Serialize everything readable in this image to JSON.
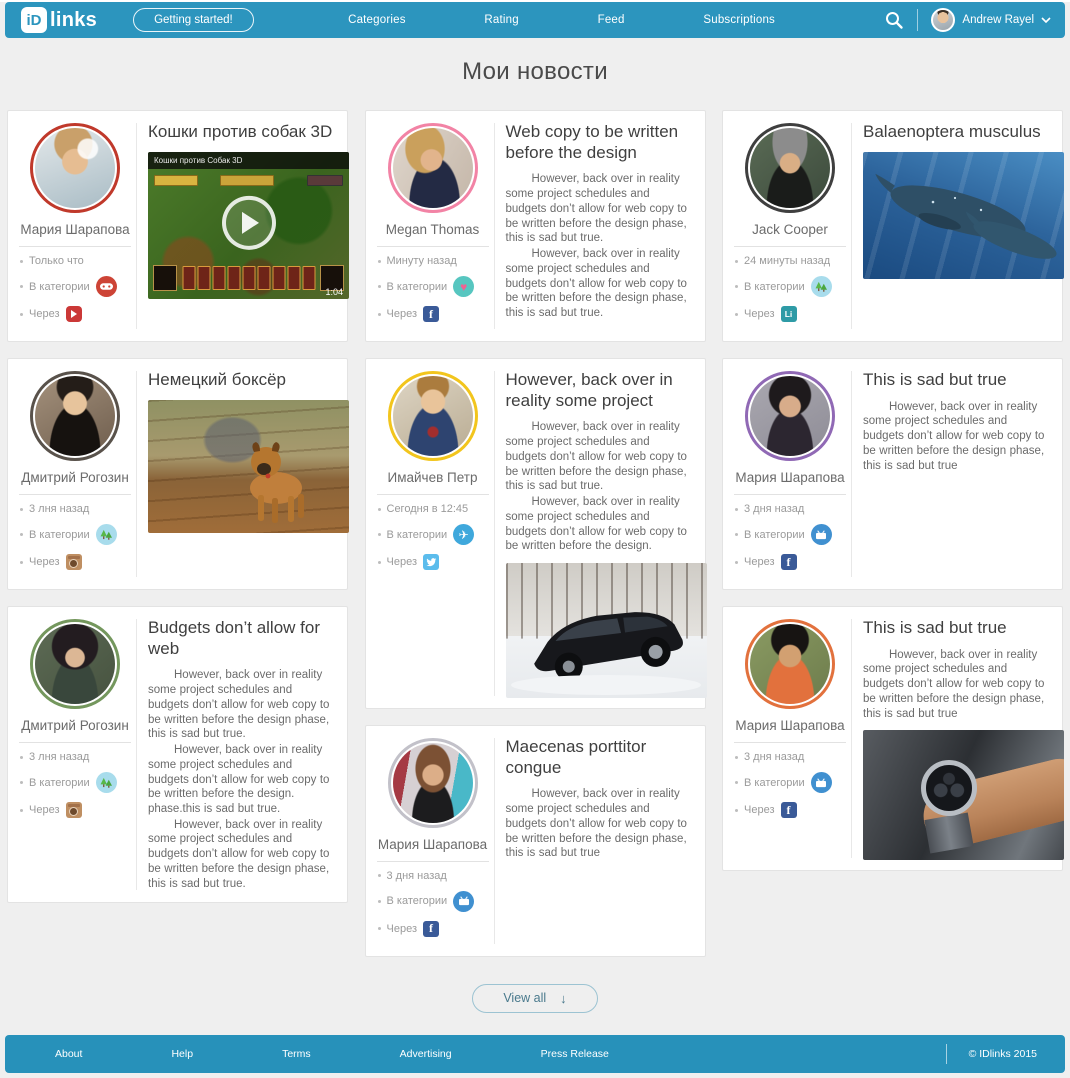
{
  "header": {
    "logo": {
      "badge": "iD",
      "text": "links"
    },
    "getting_started_label": "Getting started!",
    "nav_items": [
      "Categories",
      "Rating",
      "Feed",
      "Subscriptions"
    ],
    "user_menu": {
      "name": "Andrew Rayel"
    }
  },
  "page": {
    "title": "Мои новости"
  },
  "icons": {
    "facebook_glyph": "f",
    "linkedin_glyph": "Li",
    "heart_glyph": "♥",
    "plane_glyph": "✈",
    "view_all_arrow": "↓"
  },
  "colors": {
    "header_bg": "#2c95be",
    "footer_bg": "#2791ba",
    "page_bg": "#efefef",
    "card_bg": "#ffffff",
    "facebook_blue": "#3a5a98",
    "twitter_blue": "#5bbcec",
    "youtube_red": "#cb3837",
    "instagram_tan": "#bf8f62",
    "linkedin_teal": "#2e9ba6",
    "category_games_red": "#cd4436",
    "category_nature_blue": "#a8dcec",
    "category_heart_teal": "#57c6c0",
    "category_travel_blue": "#3fa8dc",
    "category_tv_blue": "#4090d0"
  },
  "feed": {
    "columns": [
      {
        "cards": [
          {
            "author": "Мария Шарапова",
            "avatar_ring": "#c0392b",
            "meta": {
              "time": "Только что",
              "category_label": "В категории",
              "category_icon": "games-category-icon",
              "via_label": "Через",
              "via_icon": "youtube-icon"
            },
            "title": "Кошки против собак 3D",
            "paragraphs": [],
            "media": {
              "type": "video",
              "overlay_title": "Кошки против Собак 3D",
              "duration": "1:04"
            }
          },
          {
            "author": "Дмитрий Рогозин",
            "avatar_ring": "#59524b",
            "meta": {
              "time": "3 лня назад",
              "category_label": "В категории",
              "category_icon": "nature-category-icon",
              "via_label": "Через",
              "via_icon": "instagram-icon"
            },
            "title": "Немецкий боксёр",
            "paragraphs": [],
            "media": {
              "type": "photo",
              "subject": "boxer-puppy"
            }
          },
          {
            "author": "Дмитрий Рогозин",
            "avatar_ring": "#74975d",
            "meta": {
              "time": "3 лня назад",
              "category_label": "В категории",
              "category_icon": "nature-category-icon",
              "via_label": "Через",
              "via_icon": "instagram-icon"
            },
            "title": "Budgets don’t allow for web",
            "paragraphs": [
              "However, back over in reality some project schedules and budgets don’t allow for web copy to be written before the design phase, this is sad but true.",
              "However, back over in reality some project schedules and budgets don’t allow for web copy to be written before the design. phase.this is sad but true.",
              "However, back over in reality some project schedules and budgets don’t allow for web copy to be written before the design phase, this is sad but true."
            ]
          }
        ]
      },
      {
        "cards": [
          {
            "author": "Megan Thomas",
            "avatar_ring": "#f283a5",
            "meta": {
              "time": "Минуту назад",
              "category_label": "В категории",
              "category_icon": "heart-category-icon",
              "via_label": "Через",
              "via_icon": "facebook-icon"
            },
            "title": "Web copy to be written before the design",
            "paragraphs": [
              "However, back over in reality some project schedules and budgets don’t allow for web copy to be written before the design phase, this is sad but true.",
              "However, back over in reality some project schedules and budgets don’t allow for web copy to be written before the design phase, this is sad but true."
            ]
          },
          {
            "author": "Имайчев Петр",
            "avatar_ring": "#f2c51d",
            "meta": {
              "time": "Сегодня в 12:45",
              "category_label": "В категории",
              "category_icon": "travel-category-icon",
              "via_label": "Через",
              "via_icon": "twitter-icon"
            },
            "title": "However, back over in reality some project",
            "paragraphs": [
              "However, back over in reality some project schedules and budgets don’t allow for web copy to be written before the design phase, this is sad but true.",
              "However, back over in reality some project schedules and budgets don’t allow for web copy to be written before the design."
            ],
            "media": {
              "type": "photo",
              "subject": "car-in-snow"
            }
          },
          {
            "author": "Мария Шарапова",
            "avatar_ring": "#c2c1c9",
            "meta": {
              "time": "3 дня назад",
              "category_label": "В категории",
              "category_icon": "tv-category-icon",
              "via_label": "Через",
              "via_icon": "facebook-icon"
            },
            "title": "Maecenas porttitor congue",
            "paragraphs": [
              "However, back over in reality some project schedules and budgets don’t allow for web copy to be written before the design phase, this is sad but true"
            ]
          }
        ]
      },
      {
        "cards": [
          {
            "author": "Jack Cooper",
            "avatar_ring": "#3f3f3f",
            "meta": {
              "time": "24 минуты назад",
              "category_label": "В категории",
              "category_icon": "nature-category-icon",
              "via_label": "Через",
              "via_icon": "linkedin-icon"
            },
            "title": "Balaenoptera musculus",
            "paragraphs": [],
            "media": {
              "type": "photo",
              "subject": "whales-underwater"
            }
          },
          {
            "author": "Мария Шарапова",
            "avatar_ring": "#9069b5",
            "meta": {
              "time": "3 дня назад",
              "category_label": "В категории",
              "category_icon": "tv-category-icon",
              "via_label": "Через",
              "via_icon": "facebook-icon"
            },
            "title": "This is sad but true",
            "paragraphs": [
              "However, back over in reality some project schedules and budgets don’t allow for web copy to be written before the design phase, this is sad but true"
            ]
          },
          {
            "author": "Мария Шарапова",
            "avatar_ring": "#e2713d",
            "meta": {
              "time": "3 дня назад",
              "category_label": "В категории",
              "category_icon": "tv-category-icon",
              "via_label": "Через",
              "via_icon": "facebook-icon"
            },
            "title": "This is sad but true",
            "paragraphs": [
              "However, back over in reality some project schedules and budgets don’t allow for web copy to be written before the design phase, this is sad but true"
            ],
            "media": {
              "type": "photo",
              "subject": "wrist-watch"
            }
          }
        ]
      }
    ]
  },
  "view_all": {
    "label": "View all"
  },
  "footer": {
    "links": [
      "About",
      "Help",
      "Terms",
      "Advertising",
      "Press Release"
    ],
    "copyright": "© IDlinks 2015"
  }
}
